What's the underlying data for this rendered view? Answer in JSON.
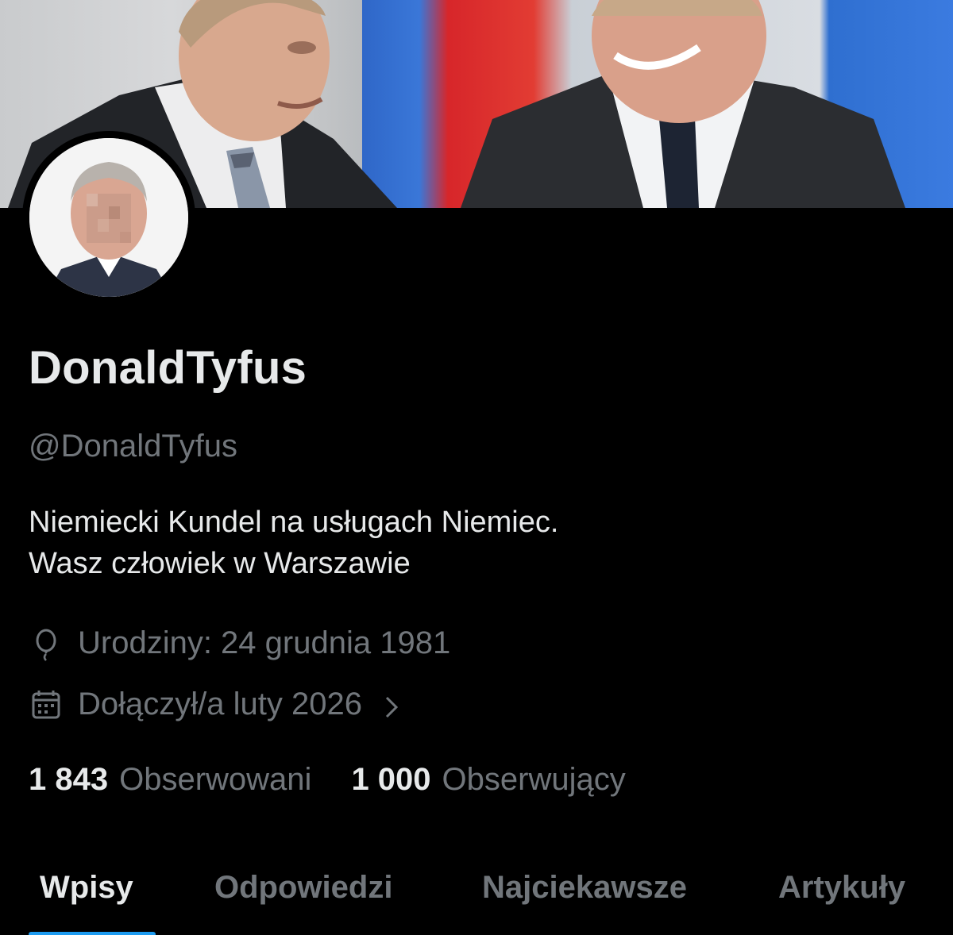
{
  "profile": {
    "display_name": "DonaldTyfus",
    "handle": "@DonaldTyfus",
    "bio_line1": "Niemiecki Kundel na usługach Niemiec.",
    "bio_line2": "Wasz człowiek w Warszawie",
    "birthday": "Urodziny: 24 grudnia 1981",
    "joined": "Dołączył/a luty 2026",
    "following_count": "1 843",
    "following_label": "Obserwowani",
    "followers_count": "1 000",
    "followers_label": "Obserwujący"
  },
  "tabs": [
    {
      "label": "Wpisy",
      "active": true
    },
    {
      "label": "Odpowiedzi",
      "active": false
    },
    {
      "label": "Najciekawsze",
      "active": false
    },
    {
      "label": "Artykuły",
      "active": false
    }
  ],
  "icons": {
    "birthday": "balloon-icon",
    "joined": "calendar-icon",
    "chevron": "chevron-right-icon"
  },
  "colors": {
    "background": "#000000",
    "text_primary": "#e7e9ea",
    "text_secondary": "#71767b",
    "accent": "#1d9bf0"
  }
}
